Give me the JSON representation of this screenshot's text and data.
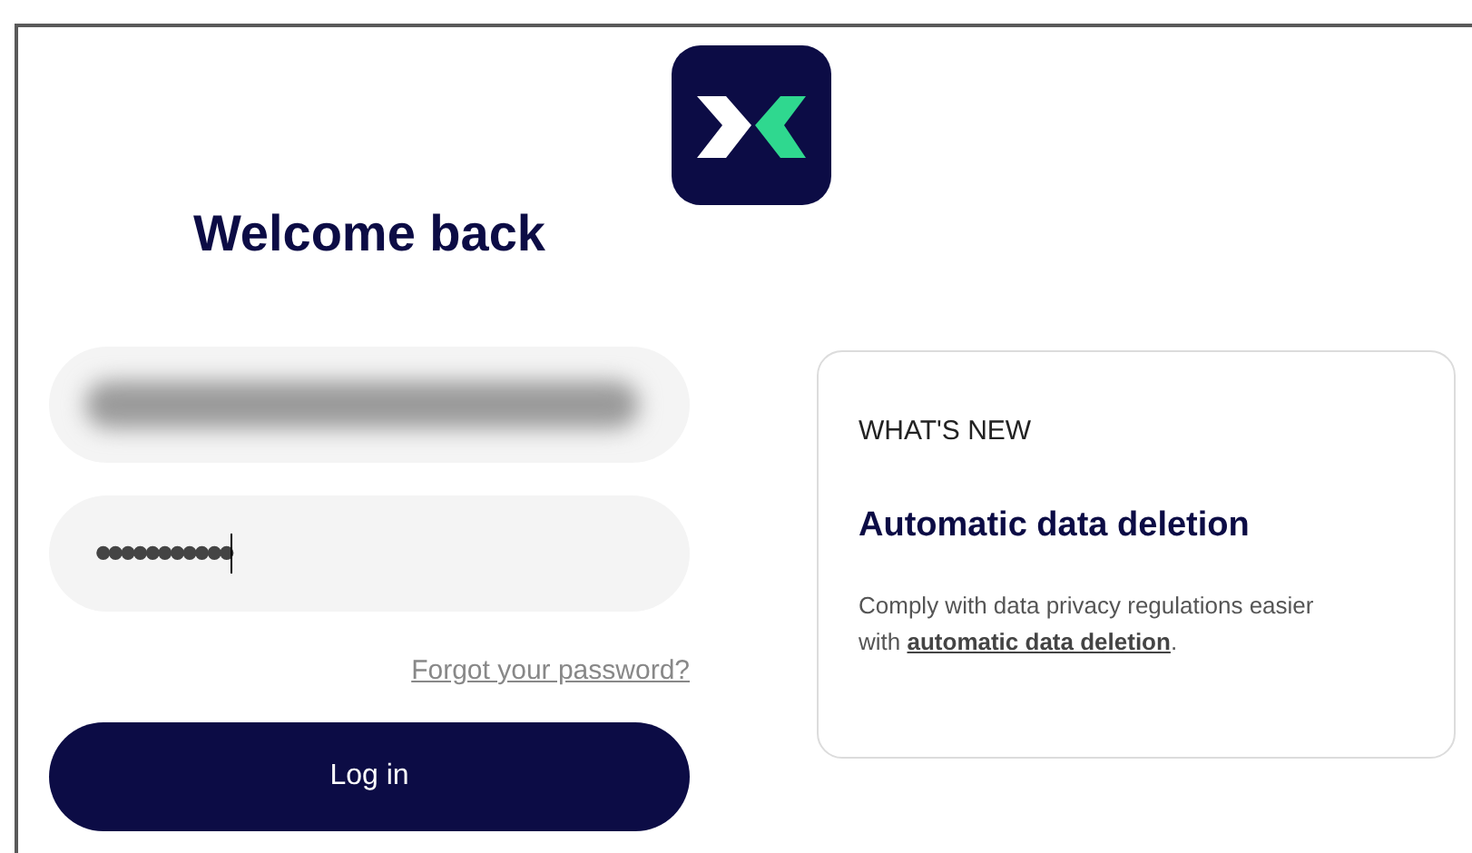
{
  "logo": {
    "kind": "app-logo"
  },
  "title": "Welcome back",
  "email_field": {
    "redacted": true
  },
  "password_field": {
    "value": "•••••••••••",
    "focused": true
  },
  "forgot_link": "Forgot your password?",
  "login_button": "Log in",
  "whats_new": {
    "label": "WHAT'S NEW",
    "heading": "Automatic data deletion",
    "body": "Comply with data privacy regulations easier with",
    "link": "automatic data deletion",
    "after_link": "."
  }
}
